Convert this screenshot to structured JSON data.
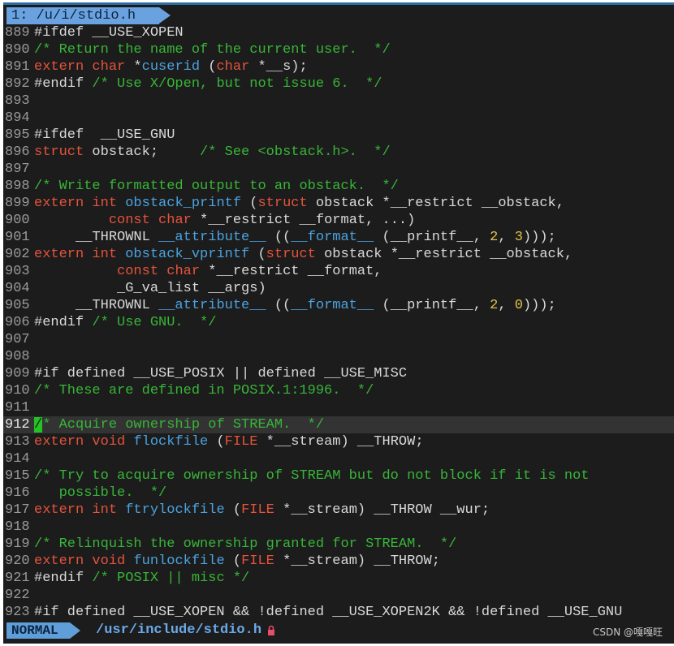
{
  "tab": {
    "label": "1: /u/i/stdio.h"
  },
  "lines": [
    {
      "n": "889",
      "tokens": [
        {
          "t": "#ifdef __USE_XOPEN",
          "c": "pre"
        }
      ]
    },
    {
      "n": "890",
      "tokens": [
        {
          "t": "/* Return the name of the current user.  */",
          "c": "cmt"
        }
      ]
    },
    {
      "n": "891",
      "tokens": [
        {
          "t": "extern",
          "c": "kw"
        },
        {
          "t": " ",
          "c": "ident"
        },
        {
          "t": "char",
          "c": "type"
        },
        {
          "t": " *",
          "c": "ident"
        },
        {
          "t": "cuserid",
          "c": "fn"
        },
        {
          "t": " (",
          "c": "ident"
        },
        {
          "t": "char",
          "c": "type"
        },
        {
          "t": " *__s);",
          "c": "ident"
        }
      ]
    },
    {
      "n": "892",
      "tokens": [
        {
          "t": "#endif",
          "c": "pre"
        },
        {
          "t": " /* Use X/Open, but not issue 6.  */",
          "c": "cmt"
        }
      ]
    },
    {
      "n": "893",
      "tokens": []
    },
    {
      "n": "894",
      "tokens": []
    },
    {
      "n": "895",
      "tokens": [
        {
          "t": "#ifdef  __USE_GNU",
          "c": "pre"
        }
      ]
    },
    {
      "n": "896",
      "tokens": [
        {
          "t": "struct",
          "c": "kw"
        },
        {
          "t": " obstack;     ",
          "c": "ident"
        },
        {
          "t": "/* See <obstack.h>.  */",
          "c": "cmt"
        }
      ]
    },
    {
      "n": "897",
      "tokens": []
    },
    {
      "n": "898",
      "tokens": [
        {
          "t": "/* Write formatted output to an obstack.  */",
          "c": "cmt"
        }
      ]
    },
    {
      "n": "899",
      "tokens": [
        {
          "t": "extern",
          "c": "kw"
        },
        {
          "t": " ",
          "c": "ident"
        },
        {
          "t": "int",
          "c": "type"
        },
        {
          "t": " ",
          "c": "ident"
        },
        {
          "t": "obstack_printf",
          "c": "fn"
        },
        {
          "t": " (",
          "c": "ident"
        },
        {
          "t": "struct",
          "c": "kw"
        },
        {
          "t": " obstack *__restrict __obstack,",
          "c": "ident"
        }
      ]
    },
    {
      "n": "900",
      "tokens": [
        {
          "t": "         ",
          "c": "ident"
        },
        {
          "t": "const",
          "c": "kw"
        },
        {
          "t": " ",
          "c": "ident"
        },
        {
          "t": "char",
          "c": "type"
        },
        {
          "t": " *__restrict __format, ...)",
          "c": "ident"
        }
      ]
    },
    {
      "n": "901",
      "tokens": [
        {
          "t": "     __THROWNL ",
          "c": "ident"
        },
        {
          "t": "__attribute__",
          "c": "fn"
        },
        {
          "t": " ((",
          "c": "ident"
        },
        {
          "t": "__format__",
          "c": "fn"
        },
        {
          "t": " (__printf__, ",
          "c": "ident"
        },
        {
          "t": "2",
          "c": "num"
        },
        {
          "t": ", ",
          "c": "ident"
        },
        {
          "t": "3",
          "c": "num"
        },
        {
          "t": ")));",
          "c": "ident"
        }
      ]
    },
    {
      "n": "902",
      "tokens": [
        {
          "t": "extern",
          "c": "kw"
        },
        {
          "t": " ",
          "c": "ident"
        },
        {
          "t": "int",
          "c": "type"
        },
        {
          "t": " ",
          "c": "ident"
        },
        {
          "t": "obstack_vprintf",
          "c": "fn"
        },
        {
          "t": " (",
          "c": "ident"
        },
        {
          "t": "struct",
          "c": "kw"
        },
        {
          "t": " obstack *__restrict __obstack,",
          "c": "ident"
        }
      ]
    },
    {
      "n": "903",
      "tokens": [
        {
          "t": "          ",
          "c": "ident"
        },
        {
          "t": "const",
          "c": "kw"
        },
        {
          "t": " ",
          "c": "ident"
        },
        {
          "t": "char",
          "c": "type"
        },
        {
          "t": " *__restrict __format,",
          "c": "ident"
        }
      ]
    },
    {
      "n": "904",
      "tokens": [
        {
          "t": "          _G_va_list __args)",
          "c": "ident"
        }
      ]
    },
    {
      "n": "905",
      "tokens": [
        {
          "t": "     __THROWNL ",
          "c": "ident"
        },
        {
          "t": "__attribute__",
          "c": "fn"
        },
        {
          "t": " ((",
          "c": "ident"
        },
        {
          "t": "__format__",
          "c": "fn"
        },
        {
          "t": " (__printf__, ",
          "c": "ident"
        },
        {
          "t": "2",
          "c": "num"
        },
        {
          "t": ", ",
          "c": "ident"
        },
        {
          "t": "0",
          "c": "num"
        },
        {
          "t": ")));",
          "c": "ident"
        }
      ]
    },
    {
      "n": "906",
      "tokens": [
        {
          "t": "#endif",
          "c": "pre"
        },
        {
          "t": " /* Use GNU.  */",
          "c": "cmt"
        }
      ]
    },
    {
      "n": "907",
      "tokens": []
    },
    {
      "n": "908",
      "tokens": []
    },
    {
      "n": "909",
      "tokens": [
        {
          "t": "#if defined __USE_POSIX || defined __USE_MISC",
          "c": "pre"
        }
      ]
    },
    {
      "n": "910",
      "tokens": [
        {
          "t": "/* These are defined in POSIX.1:1996.  */",
          "c": "cmt"
        }
      ]
    },
    {
      "n": "911",
      "tokens": []
    },
    {
      "n": "912",
      "cursor": true,
      "tokens": [
        {
          "t": "/",
          "c": "cursor"
        },
        {
          "t": "* Acquire ownership of STREAM.  */",
          "c": "cmt"
        }
      ]
    },
    {
      "n": "913",
      "tokens": [
        {
          "t": "extern",
          "c": "kw"
        },
        {
          "t": " ",
          "c": "ident"
        },
        {
          "t": "void",
          "c": "type"
        },
        {
          "t": " ",
          "c": "ident"
        },
        {
          "t": "flockfile",
          "c": "fn"
        },
        {
          "t": " (",
          "c": "ident"
        },
        {
          "t": "FILE",
          "c": "type"
        },
        {
          "t": " *__stream) __THROW;",
          "c": "ident"
        }
      ]
    },
    {
      "n": "914",
      "tokens": []
    },
    {
      "n": "915",
      "tokens": [
        {
          "t": "/* Try to acquire ownership of STREAM but do not block if it is not",
          "c": "cmt"
        }
      ]
    },
    {
      "n": "916",
      "tokens": [
        {
          "t": "   possible.  */",
          "c": "cmt"
        }
      ]
    },
    {
      "n": "917",
      "tokens": [
        {
          "t": "extern",
          "c": "kw"
        },
        {
          "t": " ",
          "c": "ident"
        },
        {
          "t": "int",
          "c": "type"
        },
        {
          "t": " ",
          "c": "ident"
        },
        {
          "t": "ftrylockfile",
          "c": "fn"
        },
        {
          "t": " (",
          "c": "ident"
        },
        {
          "t": "FILE",
          "c": "type"
        },
        {
          "t": " *__stream) __THROW __wur;",
          "c": "ident"
        }
      ]
    },
    {
      "n": "918",
      "tokens": []
    },
    {
      "n": "919",
      "tokens": [
        {
          "t": "/* Relinquish the ownership granted for STREAM.  */",
          "c": "cmt"
        }
      ]
    },
    {
      "n": "920",
      "tokens": [
        {
          "t": "extern",
          "c": "kw"
        },
        {
          "t": " ",
          "c": "ident"
        },
        {
          "t": "void",
          "c": "type"
        },
        {
          "t": " ",
          "c": "ident"
        },
        {
          "t": "funlockfile",
          "c": "fn"
        },
        {
          "t": " (",
          "c": "ident"
        },
        {
          "t": "FILE",
          "c": "type"
        },
        {
          "t": " *__stream) __THROW;",
          "c": "ident"
        }
      ]
    },
    {
      "n": "921",
      "tokens": [
        {
          "t": "#endif",
          "c": "pre"
        },
        {
          "t": " /* POSIX || misc */",
          "c": "cmt"
        }
      ]
    },
    {
      "n": "922",
      "tokens": []
    },
    {
      "n": "923",
      "tokens": [
        {
          "t": "#if defined __USE_XOPEN && !defined __USE_XOPEN2K && !defined __USE_GNU",
          "c": "pre"
        }
      ]
    }
  ],
  "statusline": {
    "mode": "NORMAL",
    "filepath": "/usr/include/stdio.h",
    "lock_icon": "lock-icon",
    "watermark": "CSDN @嘎嘎旺"
  },
  "colors": {
    "background": "#1c1c1c",
    "keyword": "#e5533c",
    "comment": "#38b538",
    "function": "#4aa3e0",
    "number": "#e0c24a",
    "tab": "#6aa2e0",
    "mode": "#5f9ed8",
    "cursor": "#22c322"
  }
}
